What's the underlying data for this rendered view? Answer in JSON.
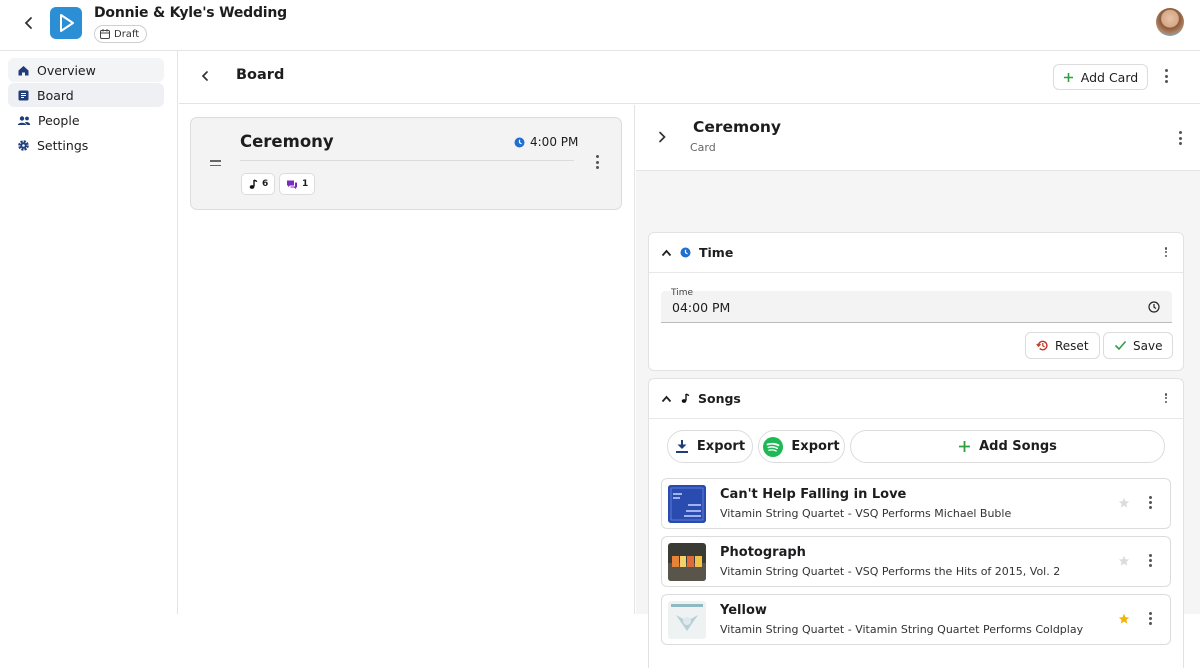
{
  "app": {
    "title": "Donnie & Kyle's Wedding",
    "status_badge": "Draft"
  },
  "sidebar": {
    "items": [
      {
        "label": "Overview",
        "icon": "home-icon"
      },
      {
        "label": "Board",
        "icon": "board-icon"
      },
      {
        "label": "People",
        "icon": "people-icon"
      },
      {
        "label": "Settings",
        "icon": "gear-icon"
      }
    ]
  },
  "board": {
    "title": "Board",
    "add_card_label": "Add Card"
  },
  "card": {
    "title": "Ceremony",
    "time": "4:00 PM",
    "song_count": "6",
    "comment_count": "1"
  },
  "detail": {
    "title": "Ceremony",
    "subtitle": "Card",
    "time_section": {
      "title": "Time",
      "field_label": "Time",
      "field_value": "04:00 PM",
      "reset_label": "Reset",
      "save_label": "Save"
    },
    "songs_section": {
      "title": "Songs",
      "export_download_label": "Export",
      "export_spotify_label": "Export",
      "add_songs_label": "Add Songs",
      "songs": [
        {
          "title": "Can't Help Falling in Love",
          "artist": "Vitamin String Quartet - VSQ Performs Michael Buble",
          "starred": false
        },
        {
          "title": "Photograph",
          "artist": "Vitamin String Quartet - VSQ Performs the Hits of 2015, Vol. 2",
          "starred": false
        },
        {
          "title": "Yellow",
          "artist": "Vitamin String Quartet - Vitamin String Quartet Performs Coldplay",
          "starred": true
        }
      ]
    }
  },
  "colors": {
    "accent": "#1f6fd1",
    "green": "#2ea043",
    "spotify": "#1db954",
    "star": "#f5b400",
    "reset": "#c0392b",
    "comment": "#7b2cbf"
  }
}
